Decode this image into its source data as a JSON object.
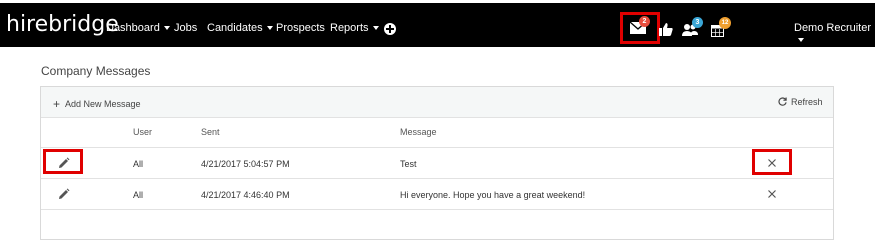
{
  "nav": {
    "brand": "hirebridge",
    "items": [
      {
        "label": "Dashboard",
        "dropdown": true
      },
      {
        "label": "Jobs",
        "dropdown": false
      },
      {
        "label": "Candidates",
        "dropdown": true
      },
      {
        "label": "Prospects",
        "dropdown": false
      },
      {
        "label": "Reports",
        "dropdown": true
      }
    ],
    "add_icon": "plus-circle-icon",
    "notifications": [
      {
        "icon": "envelope-icon",
        "count": "2",
        "badge_color": "#e74c3c"
      },
      {
        "icon": "thumbs-up-icon",
        "count": "",
        "badge_color": ""
      },
      {
        "icon": "users-icon",
        "count": "3",
        "badge_color": "#3aa6d6"
      },
      {
        "icon": "calendar-icon",
        "count": "12",
        "badge_color": "#f0a030"
      }
    ],
    "user_menu": "Demo Recruiter"
  },
  "page": {
    "title": "Company Messages"
  },
  "panel": {
    "add_label": "Add New Message",
    "refresh_label": "Refresh",
    "columns": [
      "User",
      "Sent",
      "Message"
    ],
    "rows": [
      {
        "user": "All",
        "sent": "4/21/2017 5:04:57 PM",
        "message": "Test"
      },
      {
        "user": "All",
        "sent": "4/21/2017 4:46:40 PM",
        "message": "Hi everyone. Hope you have a great weekend!"
      }
    ]
  },
  "colors": {
    "nav_bg": "#000000",
    "highlight": "#e00000",
    "panel_head_bg": "#f5f7f7"
  }
}
